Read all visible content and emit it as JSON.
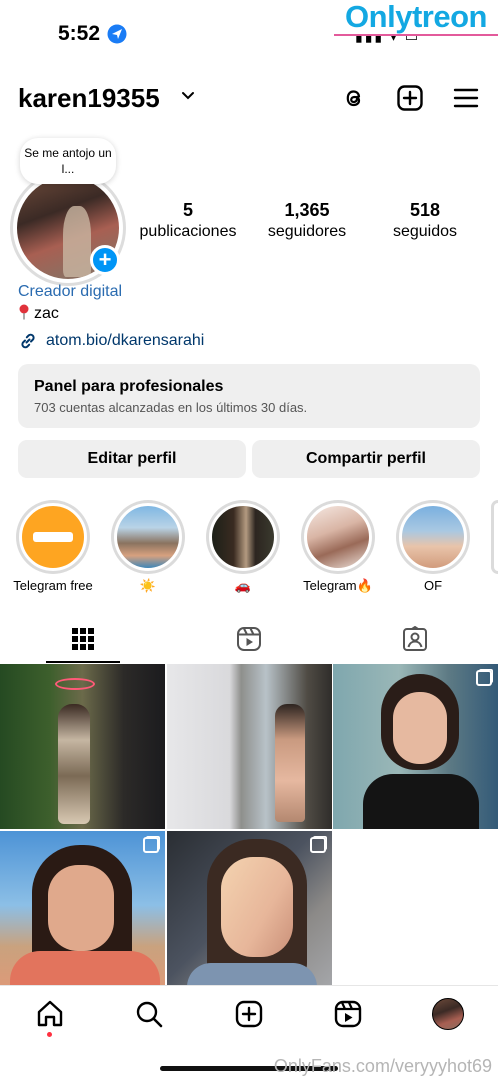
{
  "status": {
    "time": "5:52"
  },
  "watermark_top": "Onlytreon",
  "watermark_bottom": "OnlyFans.com/veryyyhot69",
  "header": {
    "username": "karen19355",
    "icons": [
      "threads-icon",
      "create-post-icon",
      "menu-icon"
    ]
  },
  "profile": {
    "note": "Se me antojo un l...",
    "stats": [
      {
        "value": "5",
        "label": "publicaciones"
      },
      {
        "value": "1,365",
        "label": "seguidores"
      },
      {
        "value": "518",
        "label": "seguidos"
      }
    ],
    "category": "Creador digital",
    "bio": "zac",
    "link": "atom.bio/dkarensarahi"
  },
  "pro_panel": {
    "title": "Panel para profesionales",
    "subtitle": "703 cuentas alcanzadas en los últimos 30 días."
  },
  "buttons": {
    "edit_profile": "Editar perfil",
    "share_profile": "Compartir perfil"
  },
  "highlights": [
    {
      "label": "Telegram free"
    },
    {
      "label": "☀️"
    },
    {
      "label": "🚗"
    },
    {
      "label": "Telegram🔥"
    },
    {
      "label": "OF"
    }
  ],
  "tabs": [
    "posts-grid-tab",
    "reels-tab",
    "tagged-tab"
  ],
  "colors": {
    "accent_blue": "#0095f6",
    "link_blue": "#00376b",
    "category_blue": "#2a6bb0",
    "notification_dot": "#ff3040"
  }
}
